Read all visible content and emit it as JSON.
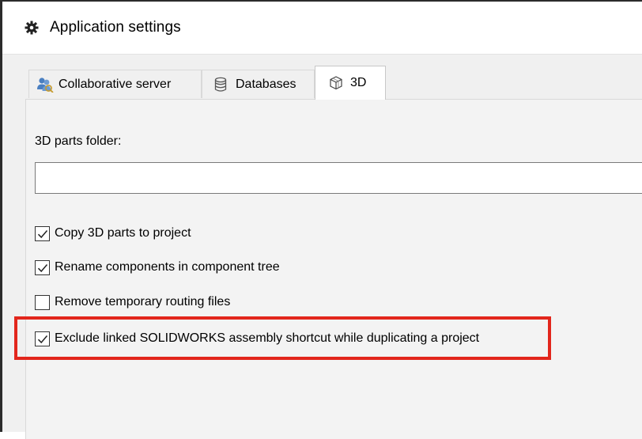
{
  "window": {
    "title": "Application settings",
    "title_icon": "gear-icon"
  },
  "tabs": [
    {
      "label": "Collaborative server",
      "icon": "users-icon",
      "active": false
    },
    {
      "label": "Databases",
      "icon": "database-icon",
      "active": false
    },
    {
      "label": "3D",
      "icon": "cube-icon",
      "active": true
    }
  ],
  "settings_3d": {
    "parts_folder_label": "3D parts folder:",
    "parts_folder_value": "",
    "options": [
      {
        "label": "Copy 3D parts to project",
        "checked": true
      },
      {
        "label": "Rename components in component tree",
        "checked": true
      },
      {
        "label": "Remove temporary routing files",
        "checked": false
      },
      {
        "label": "Exclude linked SOLIDWORKS assembly shortcut while duplicating a project",
        "checked": true
      }
    ]
  },
  "colors": {
    "highlight": "#e2261c",
    "panel_bg": "#f3f3f3",
    "window_bg": "#f0f0f0"
  }
}
